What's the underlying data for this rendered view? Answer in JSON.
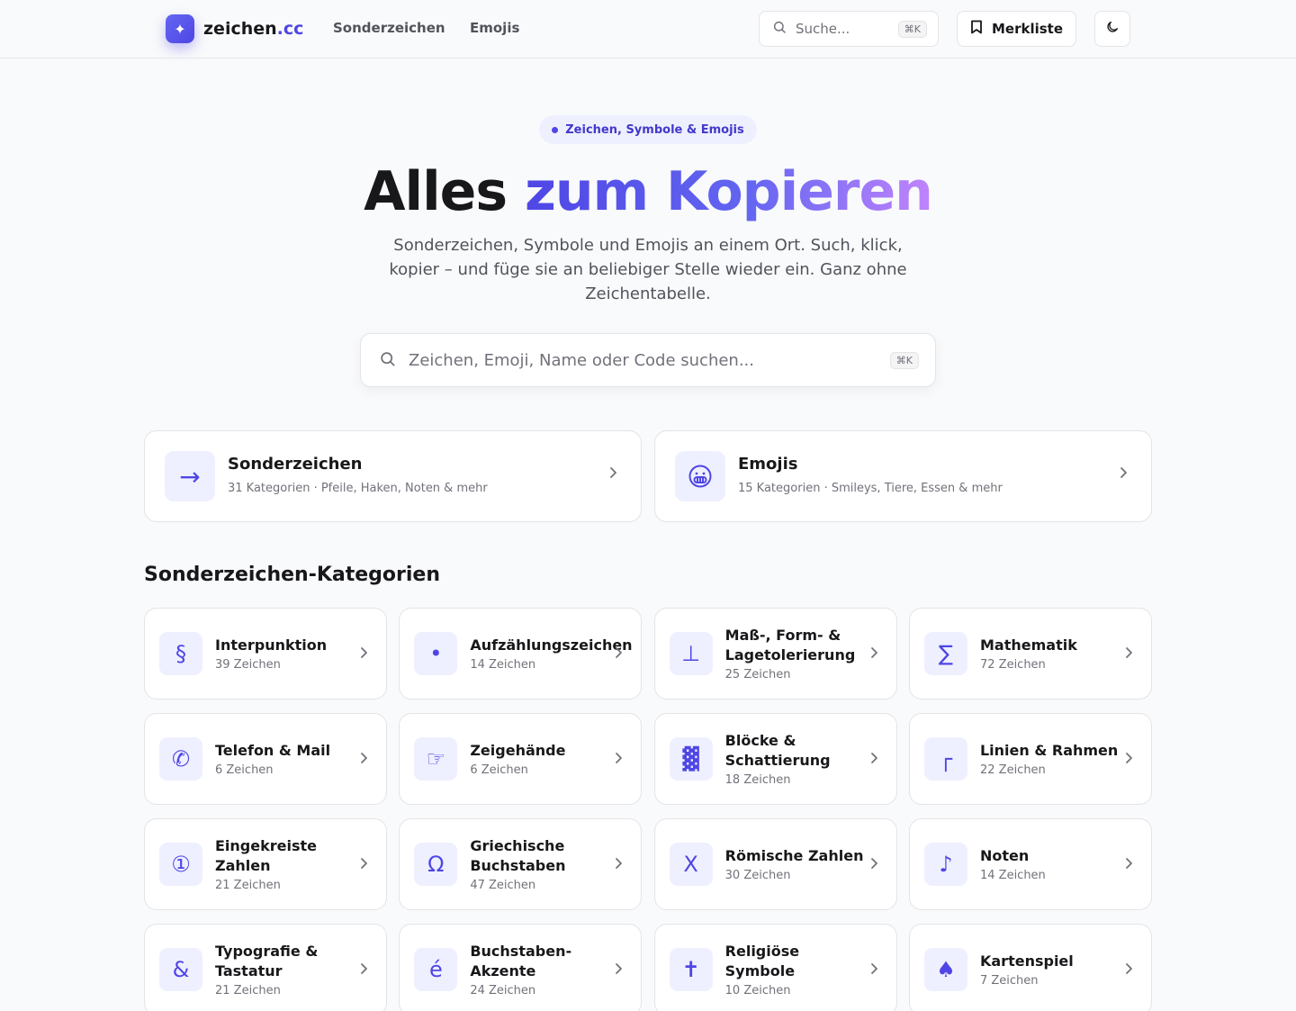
{
  "header": {
    "logo_mark": "✦",
    "logo_name": "zeichen",
    "logo_tld": ".cc",
    "nav": [
      {
        "label": "Sonderzeichen"
      },
      {
        "label": "Emojis"
      }
    ],
    "search_placeholder": "Suche...",
    "search_shortcut": "⌘K",
    "bookmark_label": "Merkliste"
  },
  "hero": {
    "badge": "Zeichen, Symbole & Emojis",
    "title_plain": "Alles ",
    "title_accent": "zum Kopieren",
    "subtitle": "Sonderzeichen, Symbole und Emojis an einem Ort. Such, klick, kopier – und füge sie an beliebiger Stelle wieder ein. Ganz ohne Zeichentabelle.",
    "search_placeholder": "Zeichen, Emoji, Name oder Code suchen...",
    "search_shortcut": "⌘K"
  },
  "overview_cards": [
    {
      "icon": "→",
      "title": "Sonderzeichen",
      "subtitle": "31 Kategorien · Pfeile, Haken, Noten & mehr"
    },
    {
      "icon": "😀",
      "title": "Emojis",
      "subtitle": "15 Kategorien · Smileys, Tiere, Essen & mehr"
    }
  ],
  "section_title": "Sonderzeichen-Kategorien",
  "categories": [
    {
      "icon": "§",
      "name": "Interpunktion",
      "count": "39 Zeichen"
    },
    {
      "icon": "•",
      "name": "Aufzählungszeichen",
      "count": "14 Zeichen"
    },
    {
      "icon": "⊥",
      "name": "Maß-, Form- & Lagetolerierung",
      "count": "25 Zeichen"
    },
    {
      "icon": "∑",
      "name": "Mathematik",
      "count": "72 Zeichen"
    },
    {
      "icon": "✆",
      "name": "Telefon & Mail",
      "count": "6 Zeichen"
    },
    {
      "icon": "☞",
      "name": "Zeigehände",
      "count": "6 Zeichen"
    },
    {
      "icon": "▓",
      "name": "Blöcke & Schattierung",
      "count": "18 Zeichen"
    },
    {
      "icon": "┌",
      "name": "Linien & Rahmen",
      "count": "22 Zeichen"
    },
    {
      "icon": "①",
      "name": "Eingekreiste Zahlen",
      "count": "21 Zeichen"
    },
    {
      "icon": "Ω",
      "name": "Griechische Buchstaben",
      "count": "47 Zeichen"
    },
    {
      "icon": "Ⅹ",
      "name": "Römische Zahlen",
      "count": "30 Zeichen"
    },
    {
      "icon": "♪",
      "name": "Noten",
      "count": "14 Zeichen"
    },
    {
      "icon": "&",
      "name": "Typografie & Tastatur",
      "count": "21 Zeichen"
    },
    {
      "icon": "é",
      "name": "Buchstaben-Akzente",
      "count": "24 Zeichen"
    },
    {
      "icon": "✝",
      "name": "Religiöse Symbole",
      "count": "10 Zeichen"
    },
    {
      "icon": "♠",
      "name": "Kartenspiel",
      "count": "7 Zeichen"
    }
  ]
}
